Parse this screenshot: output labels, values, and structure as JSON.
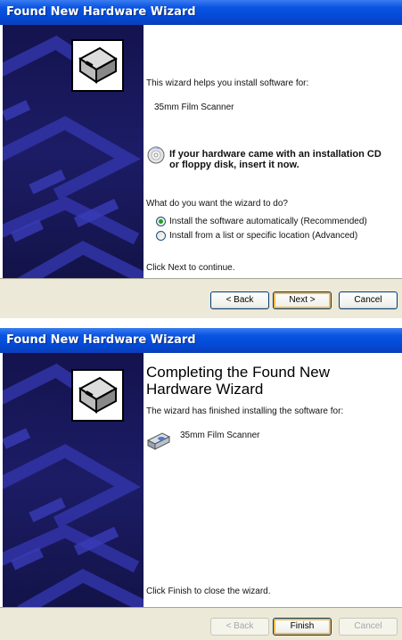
{
  "top_window": {
    "title": "Found New Hardware Wizard",
    "intro": "This wizard helps you install software for:",
    "device": "35mm Film Scanner",
    "cd_prompt_line1": "If your hardware came with an installation CD",
    "cd_prompt_line2": "or floppy disk, insert it now.",
    "question": "What do you want the wizard to do?",
    "options": [
      {
        "label": "Install the software automatically (Recommended)",
        "selected": true
      },
      {
        "label": "Install from a list or specific location (Advanced)",
        "selected": false
      }
    ],
    "continue_text": "Click Next to continue.",
    "buttons": {
      "back": "< Back",
      "next": "Next >",
      "cancel": "Cancel"
    }
  },
  "bottom_window": {
    "title": "Found New Hardware Wizard",
    "heading_line1": "Completing the Found New",
    "heading_line2": "Hardware Wizard",
    "finished_text": "The wizard has finished installing the software for:",
    "device": "35mm Film Scanner",
    "close_text": "Click Finish to close the wizard.",
    "buttons": {
      "back": "< Back",
      "finish": "Finish",
      "cancel": "Cancel"
    }
  },
  "colors": {
    "titlebar": "#0349d6",
    "sidebar": "#1c1c66",
    "default_button_glow": "#f2b84c",
    "radio_selected": "#21a121"
  },
  "icons": [
    "hardware-wizard-icon",
    "cd-icon",
    "scanner-icon",
    "radio-icon"
  ]
}
